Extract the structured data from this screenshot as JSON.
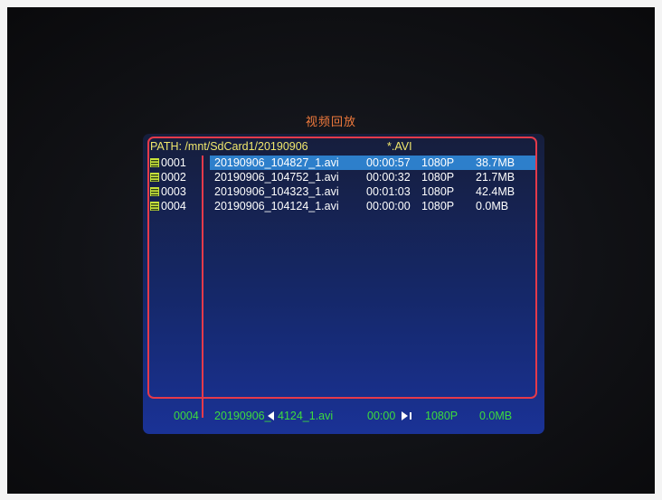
{
  "screen": {
    "title": "视频回放"
  },
  "path": {
    "label": "PATH: /mnt/SdCard1/20190906",
    "filter": "*.AVI"
  },
  "files": [
    {
      "no": "0001",
      "name": "20190906_104827_1.avi",
      "duration": "00:00:57",
      "resolution": "1080P",
      "size": "38.7MB",
      "selected": true
    },
    {
      "no": "0002",
      "name": "20190906_104752_1.avi",
      "duration": "00:00:32",
      "resolution": "1080P",
      "size": "21.7MB",
      "selected": false
    },
    {
      "no": "0003",
      "name": "20190906_104323_1.avi",
      "duration": "00:01:03",
      "resolution": "1080P",
      "size": "42.4MB",
      "selected": false
    },
    {
      "no": "0004",
      "name": "20190906_104124_1.avi",
      "duration": "00:00:00",
      "resolution": "1080P",
      "size": "0.0MB",
      "selected": false
    }
  ],
  "status": {
    "no": "0004",
    "name_prefix": "20190906_",
    "name_suffix": "4124_1.avi",
    "time": "00:00",
    "resolution": "1080P",
    "size": "0.0MB"
  },
  "colors": {
    "title": "#f07a3c",
    "path_text": "#f0e76c",
    "frame_border": "#e53a4a",
    "selection": "#2d7fcb",
    "file_icon": "#c8e23a",
    "status_text": "#3ddc3d"
  },
  "icons": {
    "file": "video-file-icon",
    "prev": "arrow-left-icon",
    "next": "arrow-right-icon"
  }
}
